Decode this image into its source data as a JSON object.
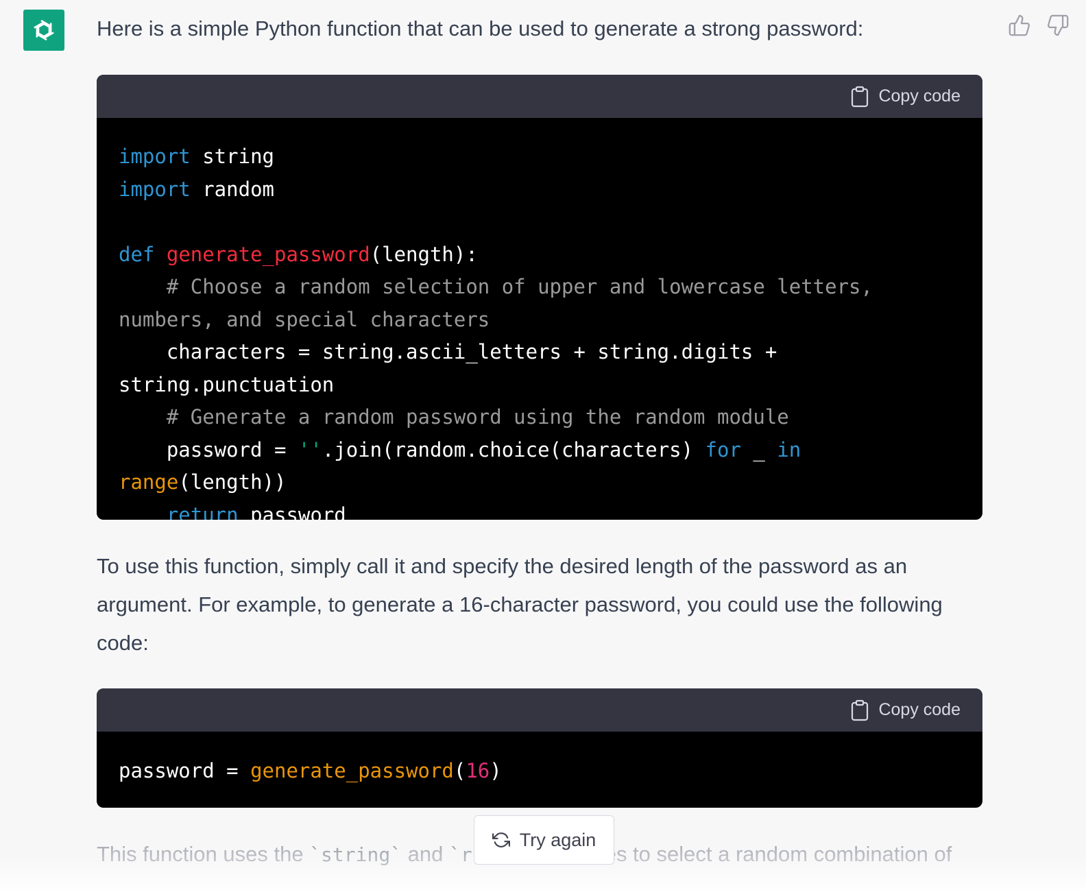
{
  "message": {
    "intro": "Here is a simple Python function that can be used to generate a strong password:",
    "usage": "To use this function, simply call it and specify the desired length of the password as an argument. For example, to generate a 16-character password, you could use the following code:",
    "bottom_prefix": "This function uses the ",
    "bottom_code1": "`string`",
    "bottom_and": " and ",
    "bottom_code2": "`r",
    "bottom_suffix": "es to select a random combination of"
  },
  "code_blocks": [
    {
      "copy_label": "Copy code"
    },
    {
      "copy_label": "Copy code"
    }
  ],
  "code1_lines": {
    "l1_kw": "import",
    "l1_rest": " string",
    "l2_kw": "import",
    "l2_rest": " random",
    "l4_kw": "def",
    "l4_fn": "generate_password",
    "l4_rest": "(length):",
    "l5_comment": "    # Choose a random selection of upper and lowercase letters, numbers, and special characters",
    "l6": "    characters = string.ascii_letters + string.digits + string.punctuation",
    "l7_comment": "    # Generate a random password using the random module",
    "l8_a": "    password = ",
    "l8_str": "''",
    "l8_b": ".join(random.choice(characters) ",
    "l8_for": "for",
    "l8_c": " _ ",
    "l8_in": "in",
    "l8_d": " ",
    "l8_range": "range",
    "l8_e": "(length))",
    "l9_indent": "    ",
    "l9_kw": "return",
    "l9_rest": " password"
  },
  "code2_line": {
    "a": "password = ",
    "fn": "generate_password",
    "p1": "(",
    "num": "16",
    "p2": ")"
  },
  "try_again": {
    "label": "Try again"
  },
  "colors": {
    "avatar_bg": "#10a37f",
    "keyword": "#2e95d3",
    "function": "#f22c3d",
    "builtin": "#e9950c",
    "number": "#df3079"
  }
}
